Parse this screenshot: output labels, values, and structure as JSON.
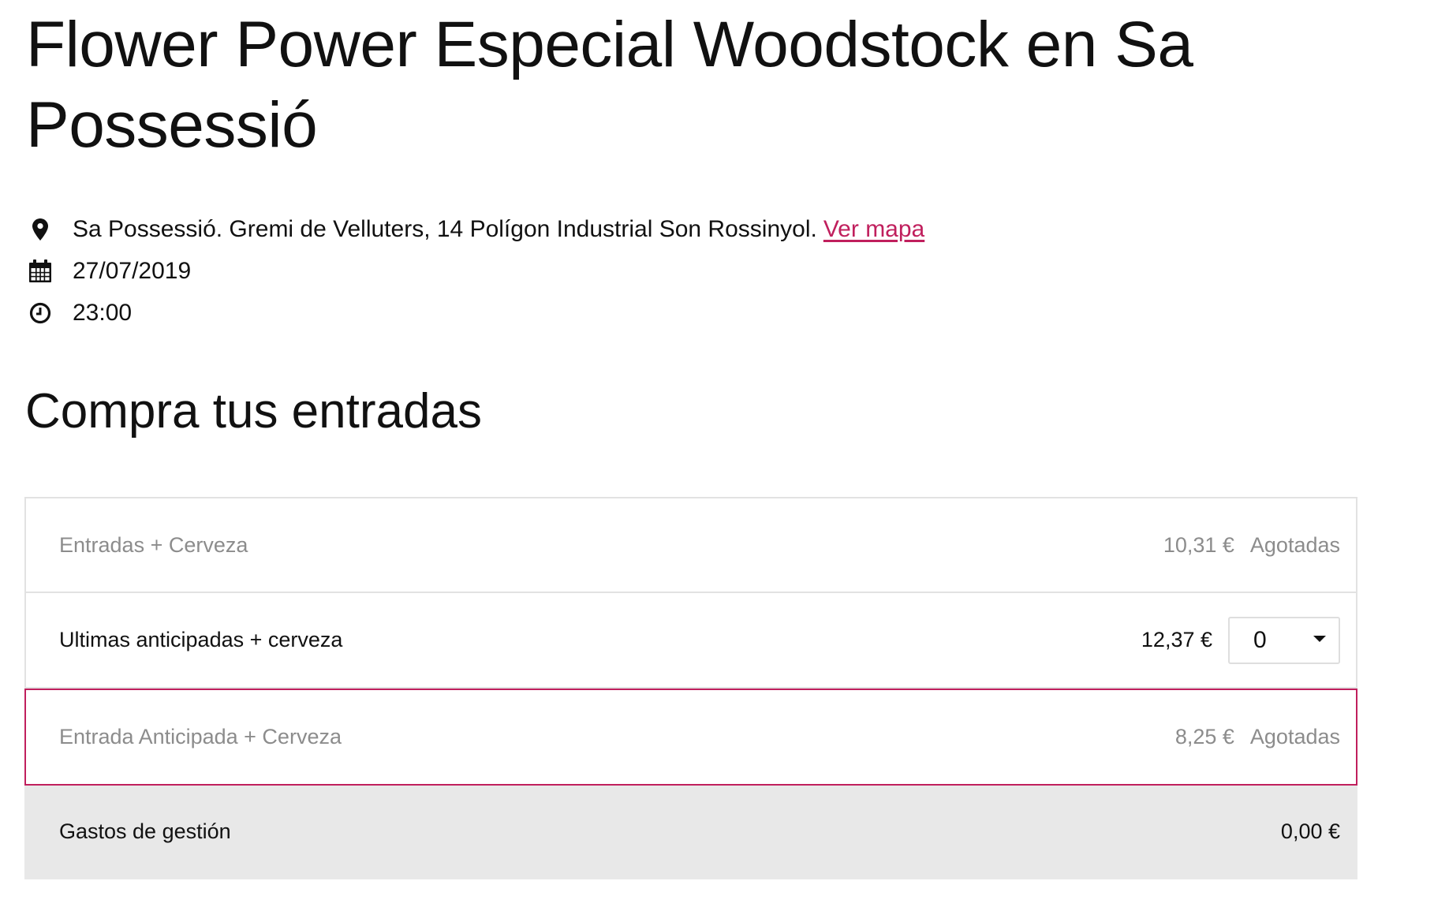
{
  "event": {
    "title": "Flower Power Especial Woodstock en Sa Possessió",
    "location": "Sa Possessió. Gremi de Velluters, 14 Polígon Industrial Son Rossinyol.",
    "map_link": "Ver mapa",
    "date": "27/07/2019",
    "time": "23:00"
  },
  "icons": {
    "location": "map-pin-icon",
    "date": "calendar-icon",
    "time": "clock-icon"
  },
  "colors": {
    "accent": "#c01f5d",
    "muted_text": "#8c8c8c",
    "fees_background": "#e8e8e8"
  },
  "tickets": {
    "title": "Compra tus entradas",
    "rows": [
      {
        "name": "Entradas + Cerveza",
        "price": "10,31 €",
        "status": "Agotadas"
      },
      {
        "name": "Ultimas anticipadas + cerveza",
        "price": "12,37 €",
        "quantity": "0"
      },
      {
        "name": "Entrada Anticipada + Cerveza",
        "price": "8,25 €",
        "status": "Agotadas"
      }
    ],
    "fees": {
      "label": "Gastos de gestión",
      "amount": "0,00 €"
    }
  }
}
